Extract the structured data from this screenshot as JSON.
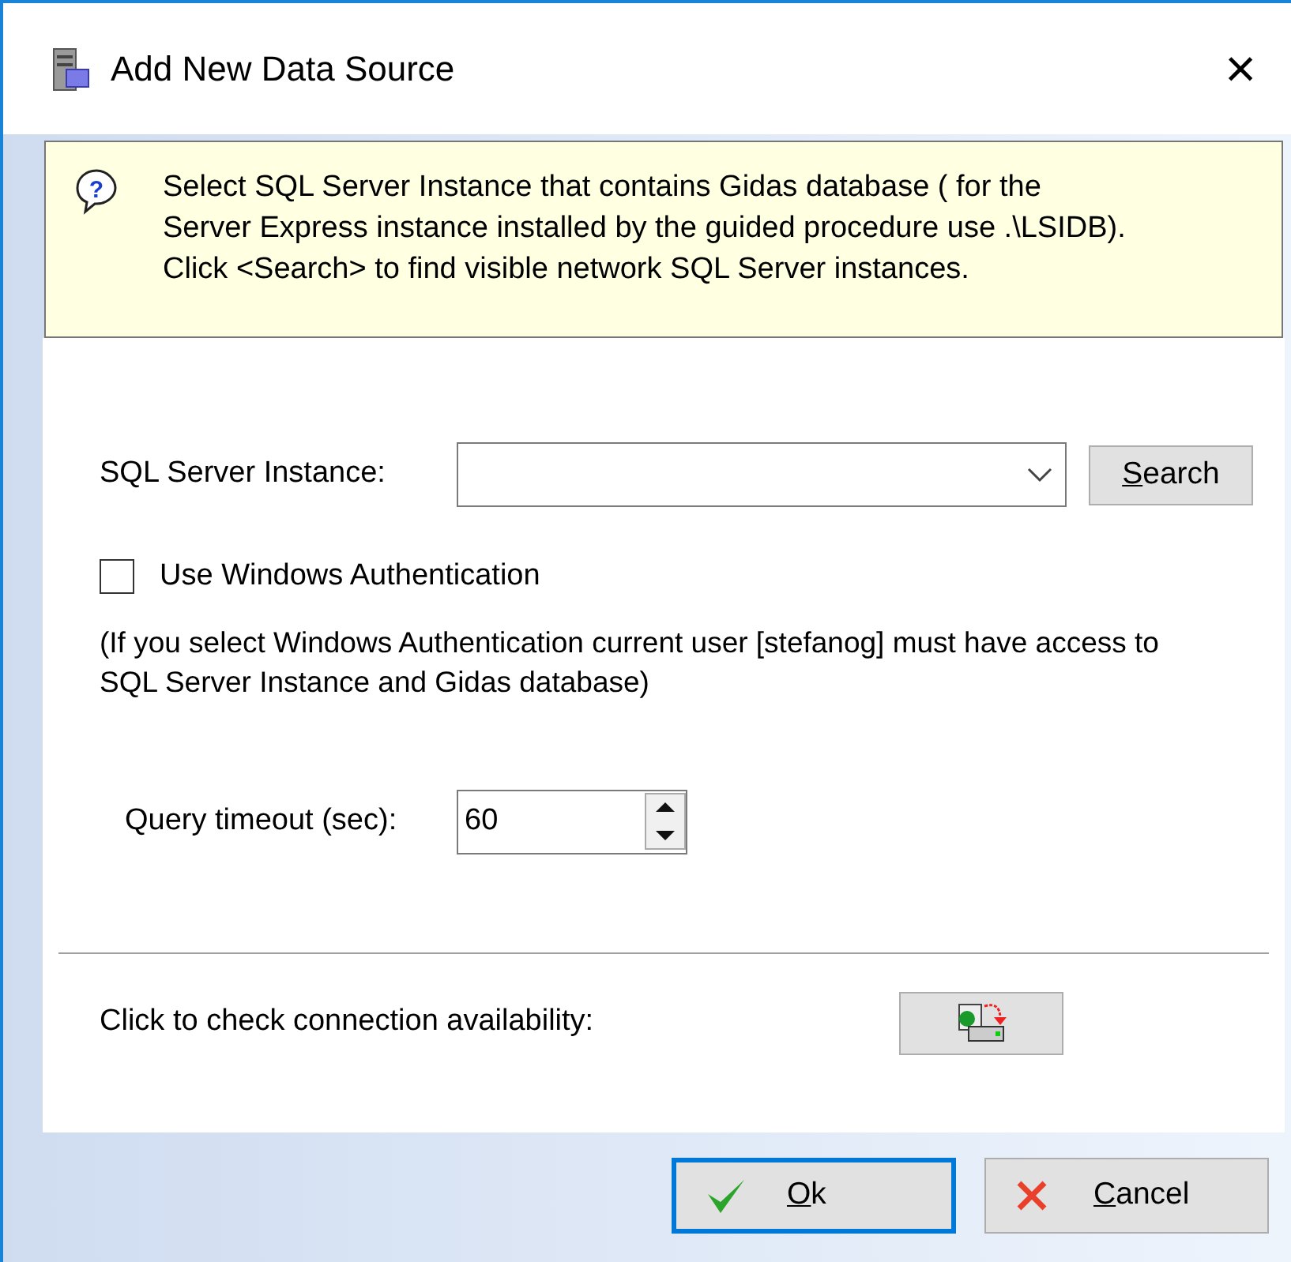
{
  "window": {
    "title": "Add New Data Source",
    "close": "×"
  },
  "info": {
    "help_icon": "?",
    "text": "Select SQL Server Instance that contains Gidas database ( for the Server Express instance installed by the guided procedure use .\\LSIDB). Click <Search> to find visible network SQL Server instances."
  },
  "instance": {
    "label": "SQL Server Instance:",
    "search_button": {
      "label": "Search",
      "mnemonic": true
    }
  },
  "windows_auth": {
    "label": "Use Windows Authentication",
    "checked": false
  },
  "auth_note": "(If you select Windows Authentication current user [stefanog] must have access to SQL Server Instance and Gidas database)",
  "timeout": {
    "label": "Query timeout (sec):",
    "value": "60"
  },
  "check": {
    "label": "Click to check connection availability:"
  },
  "buttons": [
    {
      "kind": "ok",
      "label": "Ok",
      "mnemonic": true,
      "focused": true
    },
    {
      "kind": "cancel",
      "label": "Cancel",
      "mnemonic": true,
      "focused": false
    }
  ]
}
